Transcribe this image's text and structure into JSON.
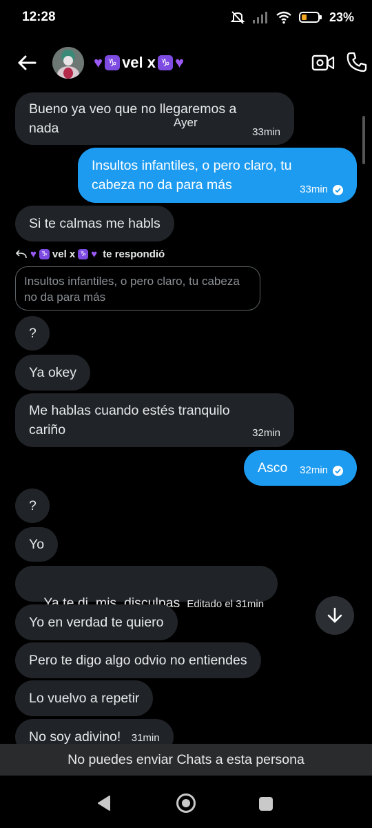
{
  "status": {
    "time": "12:28",
    "battery": "23%"
  },
  "header": {
    "contact_name_text": "vel x"
  },
  "chat": {
    "day_label": "Ayer",
    "messages": [
      {
        "line1": "Bueno ya veo que no llegaremos a",
        "line2": "nada",
        "time": "33min"
      },
      {
        "line1": "Insultos infantiles, o pero claro, tu",
        "line2": "cabeza no da para más",
        "time": "33min"
      },
      {
        "text": "Si te calmas me habls"
      },
      {
        "text": "?"
      },
      {
        "text": "Ya okey"
      },
      {
        "line1": "Me hablas cuando estés tranquilo",
        "line2": "cariño",
        "time": "32min"
      },
      {
        "text": "Asco",
        "time": "32min"
      },
      {
        "text": "?"
      },
      {
        "text": "Yo"
      },
      {
        "text": "Ya te di  mis  disculpas",
        "edited": "Editado el 31min"
      },
      {
        "text": "Yo en verdad te quiero"
      },
      {
        "text": "Pero te digo algo odvio no entiendes"
      },
      {
        "text": "Lo vuelvo a repetir"
      },
      {
        "text": "No soy adivino!",
        "time": "31min"
      }
    ],
    "reply": {
      "name_text": "vel x",
      "label": "te respondió",
      "quote_line1": "Insultos infantiles, o pero claro, tu cabeza",
      "quote_line2": "no da para más"
    }
  },
  "banner": "No puedes enviar Chats a esta persona",
  "colors": {
    "outgoing": "#1d9bf0",
    "incoming": "#202327",
    "accent_purple": "#9b59f5"
  }
}
